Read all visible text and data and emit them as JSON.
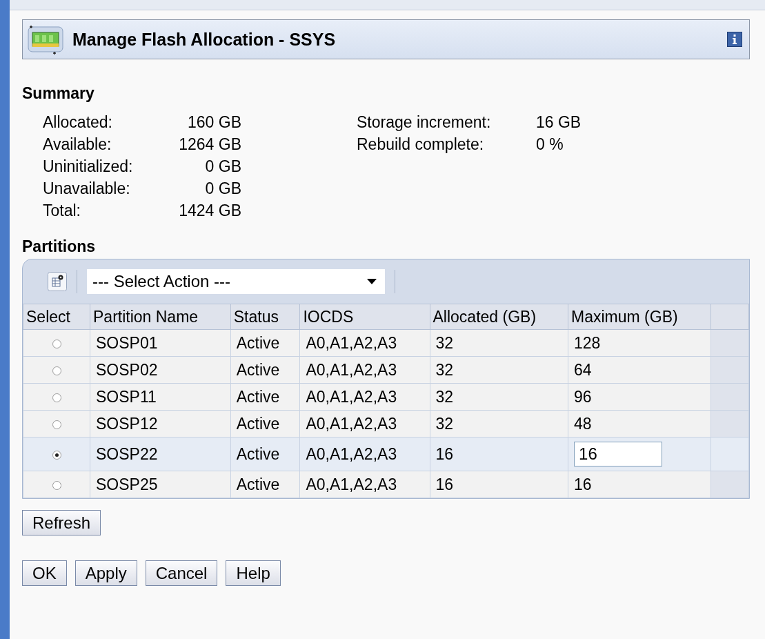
{
  "dialog": {
    "title": "Manage Flash Allocation - SSYS"
  },
  "summary": {
    "heading": "Summary",
    "left": [
      {
        "label": "Allocated:",
        "value": "160 GB"
      },
      {
        "label": "Available:",
        "value": "1264 GB"
      },
      {
        "label": "Uninitialized:",
        "value": "0 GB"
      },
      {
        "label": "Unavailable:",
        "value": "0 GB"
      },
      {
        "label": "Total:",
        "value": "1424 GB"
      }
    ],
    "right": [
      {
        "label": "Storage increment:",
        "value": "16 GB"
      },
      {
        "label": "Rebuild complete:",
        "value": "0 %"
      }
    ]
  },
  "partitions": {
    "heading": "Partitions",
    "action_select": "--- Select Action ---",
    "columns": [
      "Select",
      "Partition Name",
      "Status",
      "IOCDS",
      "Allocated (GB)",
      "Maximum (GB)"
    ],
    "rows": [
      {
        "selected": false,
        "editable": false,
        "name": "SOSP01",
        "status": "Active",
        "iocds": "A0,A1,A2,A3",
        "allocated": "32",
        "maximum": "128"
      },
      {
        "selected": false,
        "editable": false,
        "name": "SOSP02",
        "status": "Active",
        "iocds": "A0,A1,A2,A3",
        "allocated": "32",
        "maximum": "64"
      },
      {
        "selected": false,
        "editable": false,
        "name": "SOSP11",
        "status": "Active",
        "iocds": "A0,A1,A2,A3",
        "allocated": "32",
        "maximum": "96"
      },
      {
        "selected": false,
        "editable": false,
        "name": "SOSP12",
        "status": "Active",
        "iocds": "A0,A1,A2,A3",
        "allocated": "32",
        "maximum": "48"
      },
      {
        "selected": true,
        "editable": true,
        "name": "SOSP22",
        "status": "Active",
        "iocds": "A0,A1,A2,A3",
        "allocated": "16",
        "maximum": "16"
      },
      {
        "selected": false,
        "editable": false,
        "name": "SOSP25",
        "status": "Active",
        "iocds": "A0,A1,A2,A3",
        "allocated": "16",
        "maximum": "16"
      }
    ]
  },
  "refresh_button": "Refresh",
  "buttons": [
    "OK",
    "Apply",
    "Cancel",
    "Help"
  ]
}
